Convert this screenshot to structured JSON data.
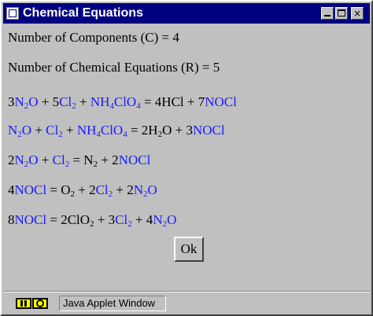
{
  "window": {
    "title": "Chemical Equations",
    "controls": {
      "minimize": "minimize-icon",
      "maximize": "maximize-icon",
      "close": "×"
    }
  },
  "info": {
    "components": "Number of Components (C) = 4",
    "reactions": "Number of Chemical Equations (R) = 5"
  },
  "equations": [
    [
      {
        "t": "3"
      },
      {
        "t": "N",
        "c": "b"
      },
      {
        "t": "2",
        "s": 1,
        "c": "b"
      },
      {
        "t": "O",
        "c": "b"
      },
      {
        "t": " + 5"
      },
      {
        "t": "Cl",
        "c": "b"
      },
      {
        "t": "2",
        "s": 1,
        "c": "b"
      },
      {
        "t": " + "
      },
      {
        "t": "NH",
        "c": "b"
      },
      {
        "t": "4",
        "s": 1,
        "c": "b"
      },
      {
        "t": "ClO",
        "c": "b"
      },
      {
        "t": "4",
        "s": 1,
        "c": "b"
      },
      {
        "t": " = 4HCl + 7"
      },
      {
        "t": "NOCl",
        "c": "b"
      }
    ],
    [
      {
        "t": "N",
        "c": "b"
      },
      {
        "t": "2",
        "s": 1,
        "c": "b"
      },
      {
        "t": "O",
        "c": "b"
      },
      {
        "t": " + "
      },
      {
        "t": "Cl",
        "c": "b"
      },
      {
        "t": "2",
        "s": 1,
        "c": "b"
      },
      {
        "t": " + "
      },
      {
        "t": "NH",
        "c": "b"
      },
      {
        "t": "4",
        "s": 1,
        "c": "b"
      },
      {
        "t": "ClO",
        "c": "b"
      },
      {
        "t": "4",
        "s": 1,
        "c": "b"
      },
      {
        "t": " = 2H"
      },
      {
        "t": "2",
        "s": 1
      },
      {
        "t": "O + 3"
      },
      {
        "t": "NOCl",
        "c": "b"
      }
    ],
    [
      {
        "t": "2"
      },
      {
        "t": "N",
        "c": "b"
      },
      {
        "t": "2",
        "s": 1,
        "c": "b"
      },
      {
        "t": "O",
        "c": "b"
      },
      {
        "t": " + "
      },
      {
        "t": "Cl",
        "c": "b"
      },
      {
        "t": "2",
        "s": 1,
        "c": "b"
      },
      {
        "t": " = N"
      },
      {
        "t": "2",
        "s": 1
      },
      {
        "t": " + 2"
      },
      {
        "t": "NOCl",
        "c": "b"
      }
    ],
    [
      {
        "t": "4"
      },
      {
        "t": "NOCl",
        "c": "b"
      },
      {
        "t": " = O"
      },
      {
        "t": "2",
        "s": 1
      },
      {
        "t": " + 2"
      },
      {
        "t": "Cl",
        "c": "b"
      },
      {
        "t": "2",
        "s": 1,
        "c": "b"
      },
      {
        "t": " + 2"
      },
      {
        "t": "N",
        "c": "b"
      },
      {
        "t": "2",
        "s": 1,
        "c": "b"
      },
      {
        "t": "O",
        "c": "b"
      }
    ],
    [
      {
        "t": "8"
      },
      {
        "t": "NOCl",
        "c": "b"
      },
      {
        "t": " = 2ClO"
      },
      {
        "t": "2",
        "s": 1
      },
      {
        "t": " + 3"
      },
      {
        "t": "Cl",
        "c": "b"
      },
      {
        "t": "2",
        "s": 1,
        "c": "b"
      },
      {
        "t": " + 4"
      },
      {
        "t": "N",
        "c": "b"
      },
      {
        "t": "2",
        "s": 1,
        "c": "b"
      },
      {
        "t": "O",
        "c": "b"
      }
    ]
  ],
  "button": {
    "ok_label": "Ok"
  },
  "status": {
    "icon": "java-applet-key-icon",
    "text": "Java Applet Window"
  },
  "colors": {
    "title_bg": "#000080",
    "window_bg": "#c0c0c0",
    "species_blue": "#1a1aff"
  }
}
